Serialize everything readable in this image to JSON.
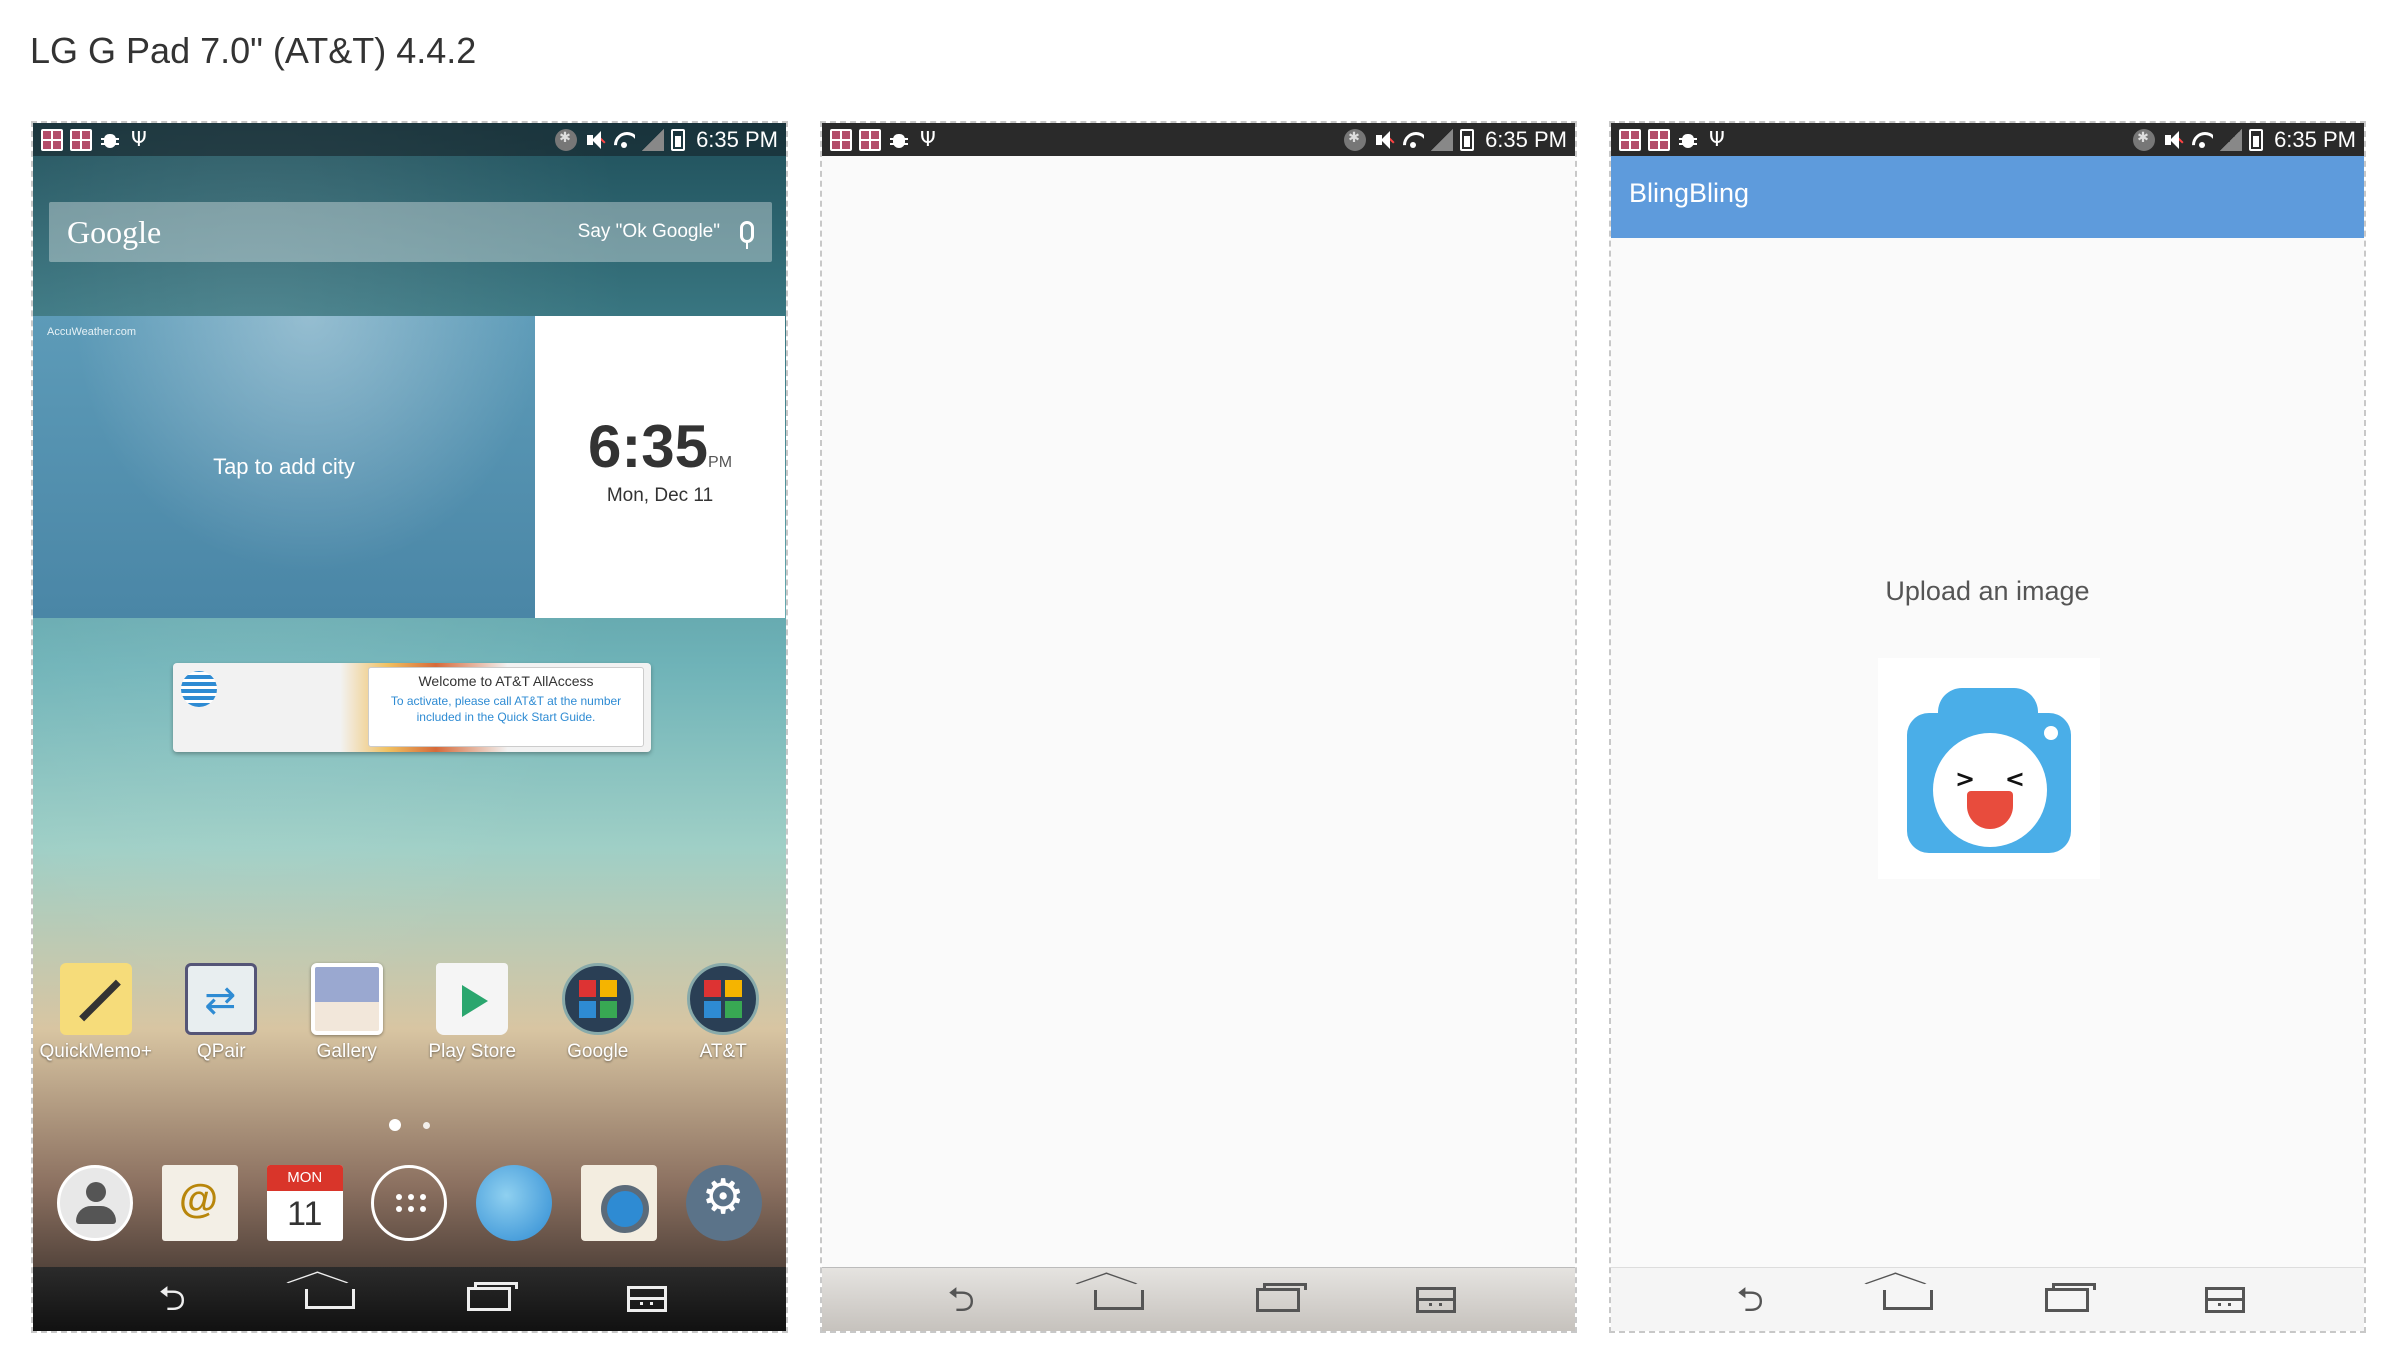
{
  "page": {
    "title": "LG G Pad 7.0\" (AT&T) 4.4.2"
  },
  "status_bar": {
    "time": "6:35 PM"
  },
  "home_screen": {
    "search": {
      "logo": "Google",
      "hint": "Say \"Ok Google\""
    },
    "weather": {
      "brand": "AccuWeather.com",
      "cta": "Tap to add city"
    },
    "clock": {
      "time": "6:35",
      "ampm": "PM",
      "date": "Mon, Dec 11"
    },
    "att_widget": {
      "title": "Welcome to AT&T AllAccess",
      "text": "To activate, please call AT&T at the number included in the Quick Start Guide."
    },
    "apps": [
      {
        "label": "QuickMemo+",
        "icon": "quickmemo-icon"
      },
      {
        "label": "QPair",
        "icon": "qpair-icon"
      },
      {
        "label": "Gallery",
        "icon": "gallery-icon"
      },
      {
        "label": "Play Store",
        "icon": "play-store-icon"
      },
      {
        "label": "Google",
        "icon": "google-folder-icon"
      },
      {
        "label": "AT&T",
        "icon": "att-folder-icon"
      }
    ],
    "dock": {
      "calendar_month": "MON",
      "calendar_day": "11",
      "icons": [
        "contacts-icon",
        "email-icon",
        "calendar-icon",
        "apps-drawer-icon",
        "browser-icon",
        "camera-icon",
        "settings-icon"
      ]
    }
  },
  "app_screen": {
    "title": "BlingBling",
    "upload_label": "Upload an image"
  }
}
